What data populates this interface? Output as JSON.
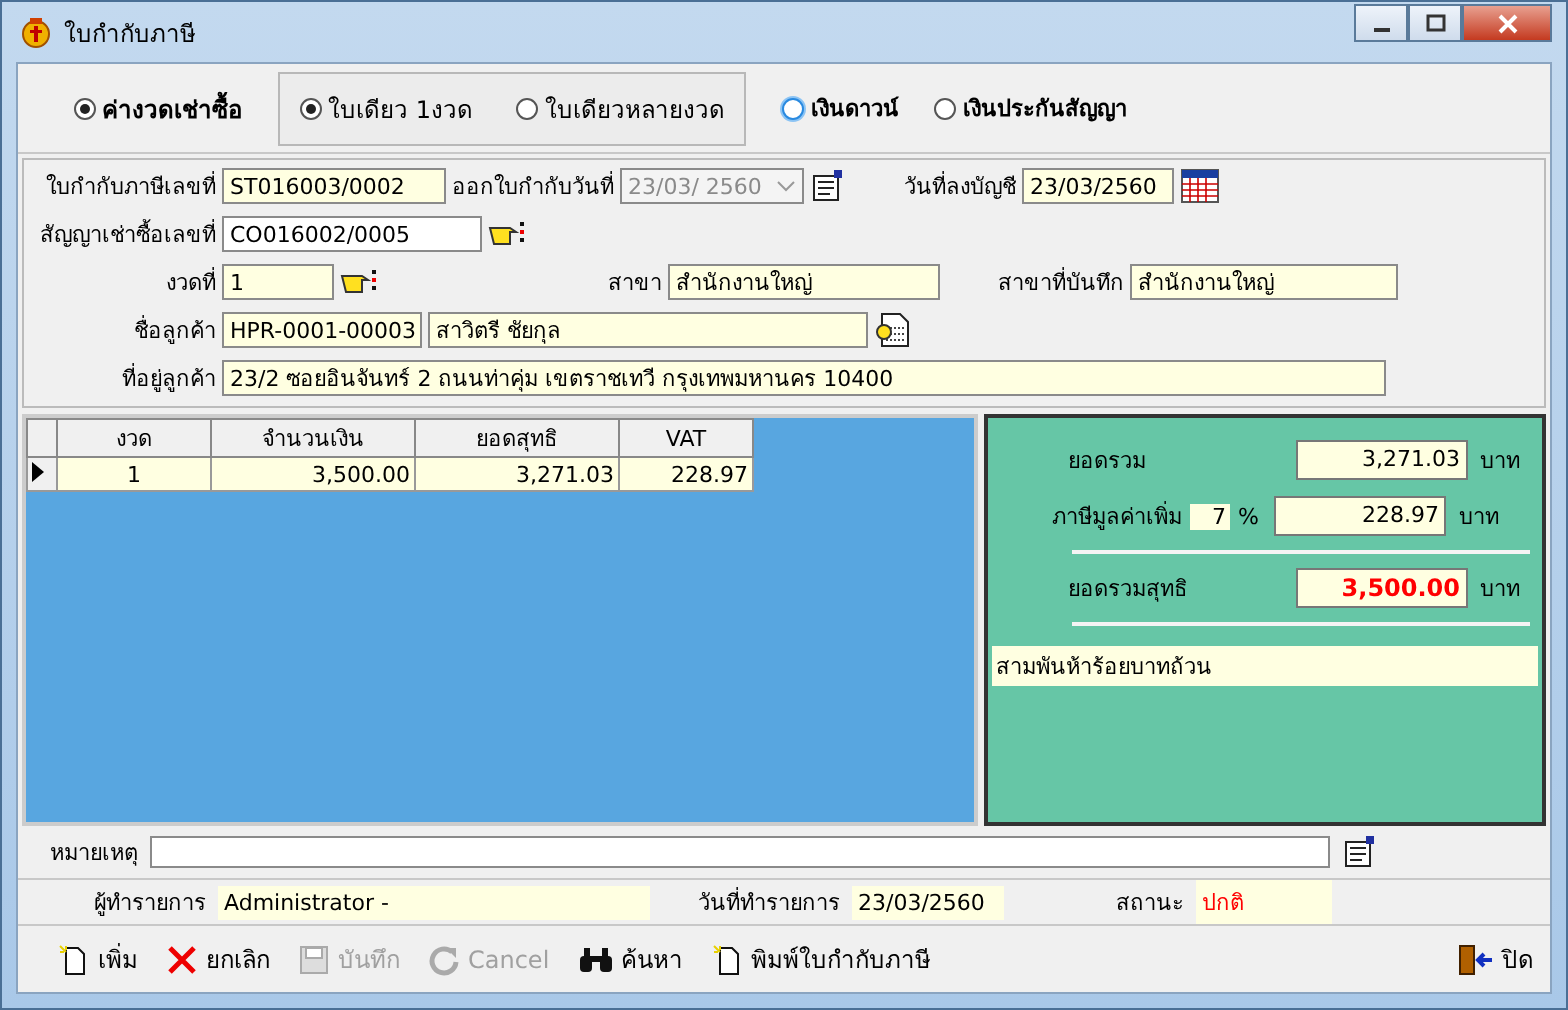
{
  "window": {
    "title": "ใบกำกับภาษี"
  },
  "payment_types": [
    {
      "label": "ค่างวดเช่าซื้อ",
      "selected": true,
      "focused": false
    },
    {
      "label": "เงินดาวน์",
      "selected": false,
      "focused": true
    },
    {
      "label": "เงินประกันสัญญา",
      "selected": false,
      "focused": false
    }
  ],
  "invoice_options": [
    {
      "label": "ใบเดียว 1งวด",
      "selected": true
    },
    {
      "label": "ใบเดียวหลายงวด",
      "selected": false
    }
  ],
  "form": {
    "tax_invoice_no": {
      "label": "ใบกำกับภาษีเลขที่",
      "value": "ST016003/0002"
    },
    "issue_date": {
      "label": "ออกใบกำกับวันที่",
      "value": "23/03/ 2560",
      "disabled": true
    },
    "posting_date": {
      "label": "วันที่ลงบัญชี",
      "value": "23/03/2560"
    },
    "contract_no": {
      "label": "สัญญาเช่าซื้อเลขที่",
      "value": "CO016002/0005"
    },
    "installment_no": {
      "label": "งวดที่",
      "value": "1"
    },
    "branch": {
      "label": "สาขา",
      "value": "สำนักงานใหญ่"
    },
    "recording_branch": {
      "label": "สาขาที่บันทึก",
      "value": "สำนักงานใหญ่"
    },
    "customer": {
      "label": "ชื่อลูกค้า",
      "code": "HPR-0001-00003",
      "name": "สาวิตรี  ชัยกุล"
    },
    "address": {
      "label": "ที่อยู่ลูกค้า",
      "value": "23/2 ซอยอินจันทร์ 2 ถนนท่าคุ่ม เขตราชเทวี กรุงเทพมหานคร 10400"
    }
  },
  "table": {
    "columns": [
      "งวด",
      "จำนวนเงิน",
      "ยอดสุทธิ",
      "VAT"
    ],
    "rows": [
      {
        "cells": [
          "1",
          "3,500.00",
          "3,271.03",
          "228.97"
        ],
        "selected": true
      }
    ]
  },
  "summary": {
    "subtotal": {
      "label": "ยอดรวม",
      "value": "3,271.03",
      "unit": "บาท"
    },
    "vat": {
      "label": "ภาษีมูลค่าเพิ่ม",
      "rate": "7",
      "percent": "%",
      "value": "228.97",
      "unit": "บาท"
    },
    "total": {
      "label": "ยอดรวมสุทธิ",
      "value": "3,500.00",
      "unit": "บาท"
    },
    "amount_text": "สามพันห้าร้อยบาทถ้วน"
  },
  "remark": {
    "label": "หมายเหตุ"
  },
  "info": {
    "operator": {
      "label": "ผู้ทำรายการ",
      "value": "Administrator -"
    },
    "date": {
      "label": "วันที่ทำรายการ",
      "value": "23/03/2560"
    },
    "status": {
      "label": "สถานะ",
      "value": "ปกติ"
    }
  },
  "toolbar": [
    {
      "label": "เพิ่ม",
      "kind": "new",
      "disabled": false
    },
    {
      "label": "ยกเลิก",
      "kind": "cancel-x",
      "disabled": false
    },
    {
      "label": "บันทึก",
      "kind": "save",
      "disabled": true
    },
    {
      "label": "Cancel",
      "kind": "undo",
      "disabled": true
    },
    {
      "label": "ค้นหา",
      "kind": "find",
      "disabled": false
    },
    {
      "label": "พิมพ์ใบกำกับภาษี",
      "kind": "new",
      "disabled": false
    }
  ],
  "close_button": {
    "label": "ปิด"
  }
}
